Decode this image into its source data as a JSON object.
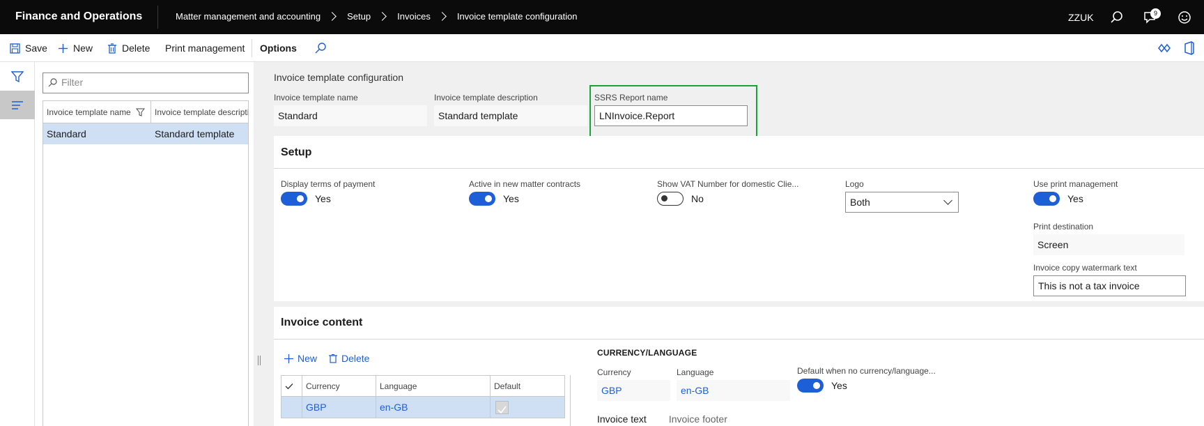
{
  "topbar": {
    "app_title": "Finance and Operations",
    "breadcrumb": [
      "Matter management and accounting",
      "Setup",
      "Invoices",
      "Invoice template configuration"
    ],
    "company": "ZZUK",
    "notification_count": "9"
  },
  "actions": {
    "save": "Save",
    "new": "New",
    "delete": "Delete",
    "print_management": "Print management",
    "options": "Options"
  },
  "list": {
    "filter_placeholder": "Filter",
    "columns": [
      "Invoice template name",
      "Invoice template description"
    ],
    "rows": [
      {
        "name": "Standard",
        "description": "Standard template"
      }
    ]
  },
  "header": {
    "title": "Invoice template configuration",
    "template_name_label": "Invoice template name",
    "template_name": "Standard",
    "template_desc_label": "Invoice template description",
    "template_desc": "Standard template",
    "ssrs_label": "SSRS Report name",
    "ssrs_value": "LNInvoice.Report"
  },
  "setup": {
    "title": "Setup",
    "display_terms_label": "Display terms of payment",
    "display_terms_value": "Yes",
    "display_terms_on": true,
    "active_new_label": "Active in new matter contracts",
    "active_new_value": "Yes",
    "active_new_on": true,
    "show_vat_label": "Show VAT Number for domestic Clie...",
    "show_vat_value": "No",
    "show_vat_on": false,
    "logo_label": "Logo",
    "logo_value": "Both",
    "use_print_label": "Use print management",
    "use_print_value": "Yes",
    "use_print_on": true,
    "print_dest_label": "Print destination",
    "print_dest_value": "Screen",
    "watermark_label": "Invoice copy watermark text",
    "watermark_value": "This is not a tax invoice"
  },
  "content": {
    "title": "Invoice content",
    "new": "New",
    "delete": "Delete",
    "columns": [
      "Currency",
      "Language",
      "Default"
    ],
    "rows": [
      {
        "currency": "GBP",
        "language": "en-GB",
        "default": true
      }
    ],
    "section_head": "CURRENCY/LANGUAGE",
    "currency_label": "Currency",
    "currency_value": "GBP",
    "language_label": "Language",
    "language_value": "en-GB",
    "default_label": "Default when no currency/language...",
    "default_value": "Yes",
    "tabs": [
      "Invoice text",
      "Invoice footer"
    ]
  },
  "colors": {
    "accent": "#1d5fd6",
    "selection": "#cfe0f5",
    "highlight_box": "#19a13a",
    "topbar": "#0b0b0b"
  }
}
